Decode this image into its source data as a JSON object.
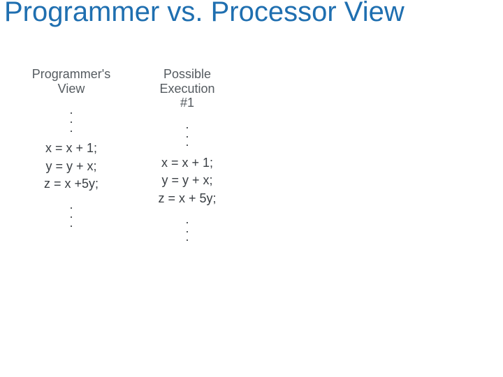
{
  "title": "Programmer vs. Processor View",
  "columns": [
    {
      "header": "Programmer's\nView",
      "lines": [
        "x = x + 1;",
        "y = y + x;",
        "z = x +5y;"
      ]
    },
    {
      "header": "Possible\nExecution\n#1",
      "lines": [
        "x = x + 1;",
        "y = y + x;",
        "z = x + 5y;"
      ]
    }
  ]
}
